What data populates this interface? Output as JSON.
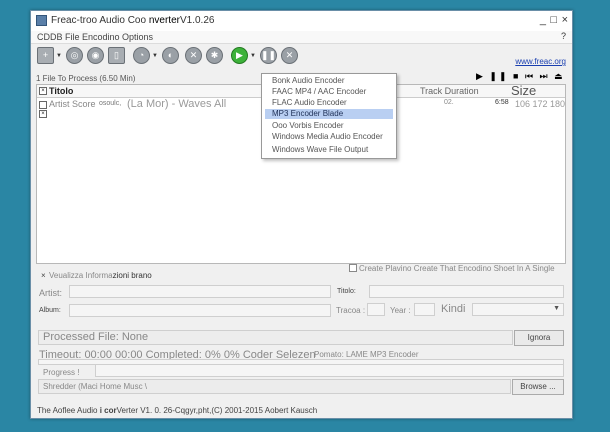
{
  "window": {
    "title_part1": "Freac-troo Audio Coo",
    "title_part2": "nverter",
    "title_part3": "V1.0.26",
    "minimize": "_",
    "maximize": "□",
    "close": "×"
  },
  "menubar": {
    "items": "CDDB File Encodino Options",
    "help": "?"
  },
  "toolbar": {
    "link": "www.freac.org",
    "icons": [
      "add-files-icon",
      "cd-icon",
      "cddb-icon",
      "file-icon",
      "search-icon",
      "cddb-submit-icon",
      "tools-icon",
      "settings-icon",
      "play-encode-icon",
      "pause-icon",
      "stop-icon"
    ]
  },
  "status": {
    "files": "1 File To Process (6.50 Min)"
  },
  "player_controls": "▶ ❚❚ ■ ⏮ ⏭ ⏏",
  "list": {
    "header": {
      "title": "Titolo",
      "track_duration": "Track Duration",
      "size": "Size"
    },
    "row": {
      "artist": "Artist Score",
      "artist2": "osoulc,",
      "title": "(La Mor) - Waves All",
      "track": "02.",
      "duration": "6:58",
      "size": "106 172 180"
    }
  },
  "encoder_menu": {
    "items": [
      "Bonk Audio Encoder",
      "FAAC MP4 / AAC Encoder",
      "FLAC Audio Encoder",
      "MP3 Encoder Blade",
      "Ooo Vorbis Encoder",
      "Windows Media Audio Encoder",
      "Windows Wave File Output"
    ],
    "selected_index": 3
  },
  "options": {
    "create_playlist": "Create Plavino Create That Encodino Shoet In A Single",
    "show_info": "Veualizza Informa",
    "show_info2": "zioni brano"
  },
  "info": {
    "artist_label": "Artist:",
    "title_label": "Titolo:",
    "album_label": "Album:",
    "track_label": "Tracoa :",
    "year_label": "Year :",
    "kind_label": "Kindi"
  },
  "progress": {
    "processed_file": "Processed File: None",
    "ignore_button": "Ignora",
    "timeout": "Timeout: 00:00 00:00 Completed: 0% 0% Coder Selezen",
    "format": "Pomato: LAME MP3 Encoder",
    "progress_label": "Progress !",
    "output_dir": "Shredder (Maci Home Musc \\",
    "browse_button": "Browse ..."
  },
  "footer": {
    "part1": "The Aoflee Audio",
    "part2": "i cor",
    "part3": "Verter V1. 0. 26-Cqgyr,pht,(C) 2001-2015 Aobert Kausch"
  }
}
